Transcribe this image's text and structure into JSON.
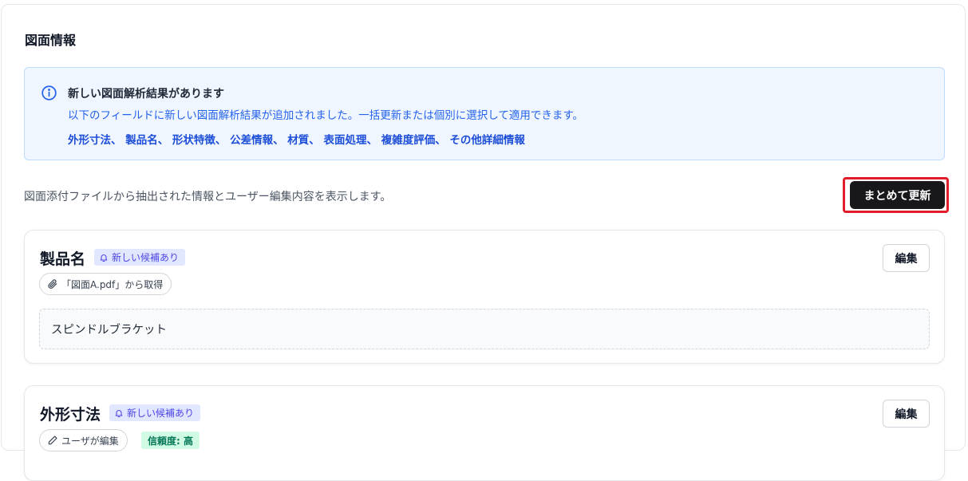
{
  "panel": {
    "title": "図面情報"
  },
  "notice": {
    "icon": "info-icon",
    "title": "新しい図面解析結果があります",
    "description": "以下のフィールドに新しい図面解析結果が追加されました。一括更新または個別に選択して適用できます。",
    "fields": "外形寸法、 製品名、 形状特徴、 公差情報、 材質、 表面処理、 複雑度評価、 その他詳細情報",
    "colors": {
      "background": "#eff6ff",
      "border": "#bfdbfe",
      "text": "#2563eb"
    }
  },
  "description": "図面添付ファイルから抽出された情報とユーザー編集内容を表示します。",
  "bulk_update": {
    "label": "まとめて更新",
    "highlight_color": "#e11d2a"
  },
  "cards": [
    {
      "title": "製品名",
      "badge": {
        "icon": "bell-icon",
        "label": "新しい候補あり"
      },
      "source_chip": {
        "icon": "paperclip-icon",
        "label": "「図面A.pdf」から取得"
      },
      "edit_label": "編集",
      "value": "スピンドルブラケット"
    },
    {
      "title": "外形寸法",
      "badge": {
        "icon": "bell-icon",
        "label": "新しい候補あり"
      },
      "source_chip": {
        "icon": "pencil-icon",
        "label": "ユーザが編集"
      },
      "confidence": "信頼度: 高",
      "edit_label": "編集"
    }
  ]
}
